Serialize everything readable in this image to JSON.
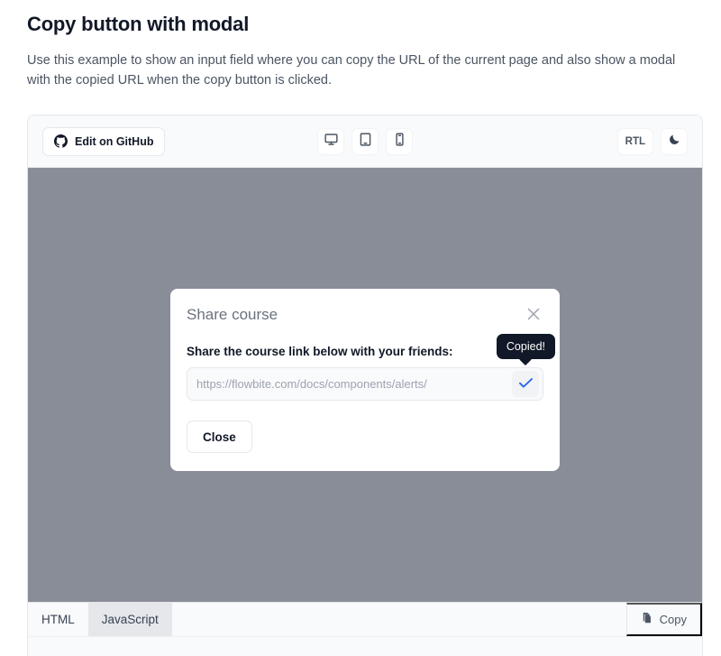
{
  "page": {
    "title": "Copy button with modal",
    "description": "Use this example to show an input field where you can copy the URL of the current page and also show a modal with the copied URL when the copy button is clicked."
  },
  "toolbar": {
    "github_button": "Edit on GitHub",
    "github_icon": "github-icon",
    "devices": [
      {
        "name": "desktop-view",
        "icon": "desktop-icon"
      },
      {
        "name": "tablet-view",
        "icon": "tablet-icon"
      },
      {
        "name": "mobile-view",
        "icon": "mobile-icon"
      }
    ],
    "rtl_label": "RTL",
    "theme_icon": "moon-icon"
  },
  "preview": {
    "backdrop_color": "#898d97"
  },
  "modal": {
    "title": "Share course",
    "close_icon": "close-icon",
    "share_label": "Share the course link below with your friends:",
    "url_value": "https://flowbite.com/docs/components/alerts/",
    "copy_icon": "check-icon",
    "tooltip": "Copied!",
    "close_button": "Close",
    "accent_color": "#2563eb",
    "tooltip_bg": "#111827"
  },
  "tabs": {
    "items": [
      {
        "label": "HTML",
        "active": false
      },
      {
        "label": "JavaScript",
        "active": true
      }
    ],
    "copy_label": "Copy",
    "copy_icon": "clipboard-copy-icon"
  }
}
